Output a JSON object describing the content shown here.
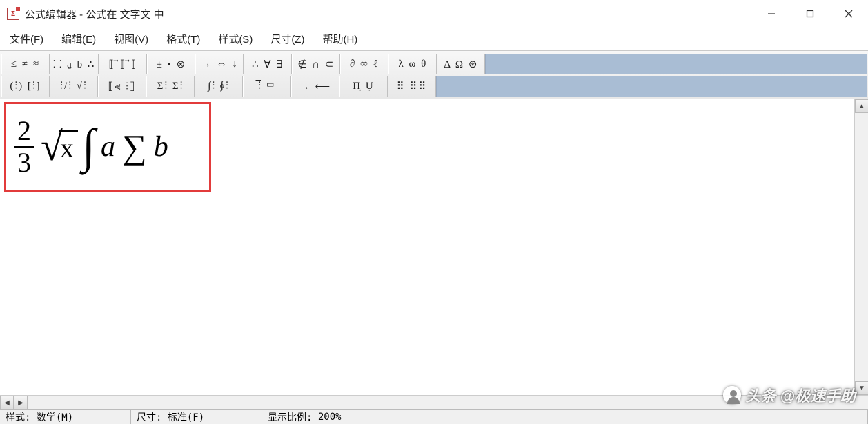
{
  "title": "公式编辑器 - 公式在 文字文 中",
  "menu": {
    "file": "文件(F)",
    "edit": "编辑(E)",
    "view": "视图(V)",
    "format": "格式(T)",
    "style": "样式(S)",
    "size": "尺寸(Z)",
    "help": "帮助(H)"
  },
  "toolbar_row1": [
    "≤ ≠ ≈",
    "⸬ a̱ b ∴",
    "⟦ ⃗⟧ ⃗⟧",
    "± • ⊗",
    "→ ⇔ ↓",
    "∴ ∀ ∃",
    "∉ ∩ ⊂",
    "∂ ∞ ℓ",
    "λ ω θ",
    "Δ Ω ⊛"
  ],
  "toolbar_row2": [
    "(⫶) [⫶]",
    "⫶/⫶  √⫶",
    "⟦⫷  ⫶⟧",
    "Σ⫶ Σ⫶",
    "∫⫶ ∮⫶",
    "⫶̅  ▭",
    "→  ⟵",
    "Π̣  Ụ",
    "⠿ ⠿⠿"
  ],
  "formula": {
    "frac_num": "2",
    "frac_den": "3",
    "sqrt_body": "x",
    "var_a": "a",
    "var_b": "b"
  },
  "status": {
    "style_label": "样式:",
    "style_value": "数学(M)",
    "size_label": "尺寸:",
    "size_value": "标准(F)",
    "zoom_label": "显示比例:",
    "zoom_value": "200%"
  },
  "watermark": "头条 @极速手助"
}
